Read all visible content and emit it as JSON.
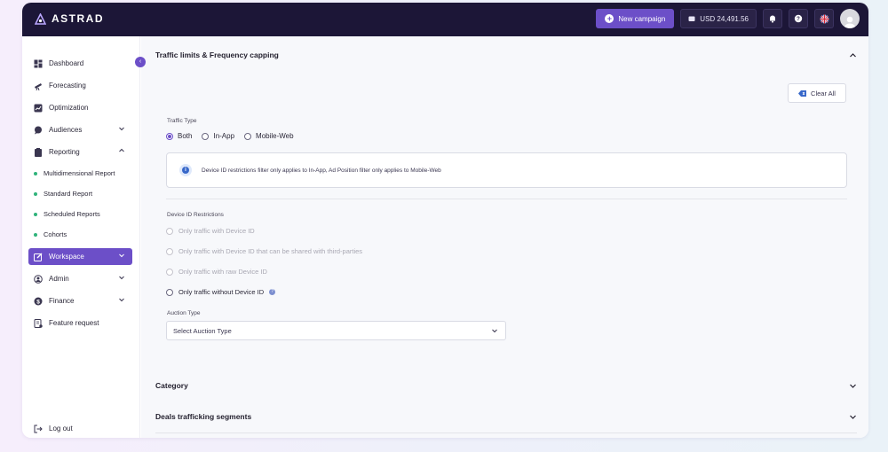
{
  "brand": {
    "name": "ASTRAD"
  },
  "header": {
    "new_campaign_label": "New campaign",
    "balance": "USD 24,491.56"
  },
  "sidebar": {
    "items": [
      {
        "label": "Dashboard",
        "icon": "dashboard-icon"
      },
      {
        "label": "Forecasting",
        "icon": "telescope-icon"
      },
      {
        "label": "Optimization",
        "icon": "chart-icon"
      },
      {
        "label": "Audiences",
        "icon": "chat-icon"
      },
      {
        "label": "Reporting",
        "icon": "clipboard-icon"
      },
      {
        "label": "Workspace",
        "icon": "edit-icon"
      },
      {
        "label": "Admin",
        "icon": "shield-icon"
      },
      {
        "label": "Finance",
        "icon": "dollar-icon"
      },
      {
        "label": "Feature request",
        "icon": "request-icon"
      }
    ],
    "reporting_sub": [
      "Multidimensional Report",
      "Standard Report",
      "Scheduled Reports",
      "Cohorts"
    ],
    "logout_label": "Log out",
    "collapse_badge": "‹"
  },
  "main": {
    "section_title": "Traffic limits & Frequency capping",
    "clear_all_label": "Clear All",
    "traffic_type": {
      "label": "Traffic Type",
      "options": [
        "Both",
        "In-App",
        "Mobile-Web"
      ],
      "selected": "Both"
    },
    "info_text": "Device ID restrictions filter only applies to In-App, Ad Position filter only applies to Mobile-Web",
    "device_id": {
      "label": "Device ID Restrictions",
      "options": [
        "Only traffic with Device ID",
        "Only traffic with Device ID that can be shared with third-parties",
        "Only traffic with raw Device ID",
        "Only traffic without Device ID"
      ]
    },
    "auction": {
      "label": "Auction Type",
      "placeholder": "Select Auction Type"
    },
    "collapsed_sections": [
      "Category",
      "Deals trafficking segments"
    ]
  },
  "colors": {
    "topbar": "#1c1637",
    "accent": "#6c4fc8",
    "status_dot": "#2fb37a"
  }
}
